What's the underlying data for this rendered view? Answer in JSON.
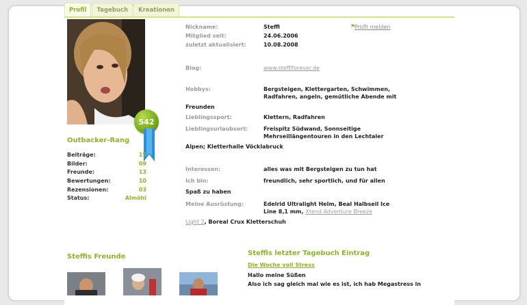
{
  "tabs": [
    "Profil",
    "Tagebuch",
    "Kreationen"
  ],
  "report_link": "Profil melden",
  "profile": {
    "nickname_label": "Nickname:",
    "nickname": "Steffi",
    "member_since_label": "Mitglied seit:",
    "member_since": "24.06.2006",
    "updated_label": "zuletzt aktualisiert:",
    "updated": "10.08.2008",
    "blog_label": "Blog:",
    "blog": "www.steffiforever.de",
    "hobbies_label": "Hobbys:",
    "hobbies_line1": "Bergsteigen, Klettergarten, Schwimmen,",
    "hobbies_line2": "Radfahren, angeln, gemütliche Abende mit",
    "hobbies_line3": "Freunden",
    "sport_label": "Lieblingssport:",
    "sport": "Klettern, Radfahren",
    "vacation_label": "Lieblingsurlaubsort:",
    "vacation_line1": "Freispitz Südwand, Sonnseitige",
    "vacation_line2": "Mehrseillängentouren in den Lechtaler",
    "vacation_line3": "Alpen; Kletterhalle Vöcklabruck",
    "interests_label": "Interessen:",
    "interests": "alles was mit Bergsteigen zu tun hat",
    "iam_label": "Ich bin:",
    "iam_line1": "freundlich, sehr sportlich, und für allen",
    "iam_line2": "Spaß zu haben",
    "gear_label": "Meine Ausrüstung:",
    "gear_line1": "Edelrid Ultralight Helm, Beal Halbseil Ice",
    "gear_line2_text": "Line 8,1 mm,",
    "gear_line2_link": "Xtend Adventure Breeze",
    "gear_line3_link": "Light 2",
    "gear_line3_text": ", Boreal Crux Kletterschuh"
  },
  "rank": {
    "points": "542",
    "title": "Outbacker-Rang",
    "stats": [
      {
        "label": "Beiträge:",
        "value": "15"
      },
      {
        "label": "Bilder:",
        "value": "09"
      },
      {
        "label": "Freunde:",
        "value": "13"
      },
      {
        "label": "Bewertungen:",
        "value": "10"
      },
      {
        "label": "Rezensionen:",
        "value": "03"
      },
      {
        "label": "Status:",
        "value": "Almöhi"
      }
    ]
  },
  "friends_title": "Steffis Freunde",
  "diary": {
    "title": "Steffis letzter Tagebuch Eintrag",
    "entry_title": "Die Woche voll Stress",
    "line1": "Hallo meine Süßen",
    "line2": "Also ich sag gleich mal wie es ist, ich hab Megastress in"
  },
  "colors": {
    "accent": "#8db32a",
    "tab_bg": "#f3f5d8",
    "border": "#d3e37e"
  }
}
